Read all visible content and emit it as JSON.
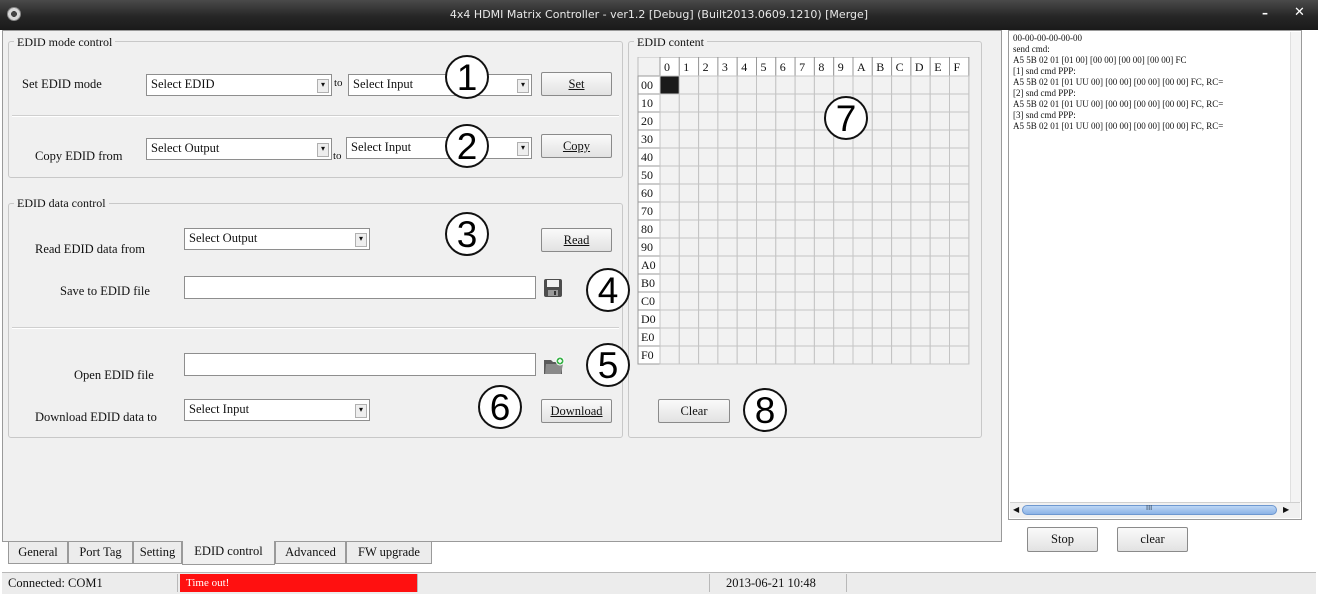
{
  "window": {
    "title": "4x4 HDMI Matrix Controller - ver1.2 [Debug]  (Built2013.0609.1210) [Merge]",
    "minimize_glyph": "–",
    "close_glyph": "✕"
  },
  "mode_control": {
    "group_title": "EDID mode control",
    "set_label": "Set EDID mode",
    "set_source": "Select EDID",
    "to_label": "to",
    "set_target": "Select Input",
    "set_button": "Set",
    "copy_label": "Copy EDID from",
    "copy_source": "Select Output",
    "copy_target": "Select Input",
    "copy_button": "Copy"
  },
  "data_control": {
    "group_title": "EDID data control",
    "read_label": "Read EDID data from",
    "read_source": "Select Output",
    "read_button": "Read",
    "save_label": "Save to EDID file",
    "save_value": "",
    "open_label": "Open EDID file",
    "open_value": "",
    "download_label": "Download EDID data to",
    "download_target": "Select Input",
    "download_button": "Download"
  },
  "edid_content": {
    "group_title": "EDID content",
    "columns": [
      "0",
      "1",
      "2",
      "3",
      "4",
      "5",
      "6",
      "7",
      "8",
      "9",
      "A",
      "B",
      "C",
      "D",
      "E",
      "F"
    ],
    "rows": [
      "00",
      "10",
      "20",
      "30",
      "40",
      "50",
      "60",
      "70",
      "80",
      "90",
      "A0",
      "B0",
      "C0",
      "D0",
      "E0",
      "F0"
    ],
    "selected_cell": {
      "row": "00",
      "col": "0"
    },
    "clear_button": "Clear"
  },
  "callouts": [
    "1",
    "2",
    "3",
    "4",
    "5",
    "6",
    "7",
    "8"
  ],
  "log": {
    "lines": [
      "00-00-00-00-00-00",
      "send cmd:",
      "A5 5B 02 01 [01 00] [00 00] [00 00] [00 00] FC",
      "[1] snd cmd PPP:",
      "A5 5B 02 01 [01 UU 00] [00 00] [00 00] [00 00] FC, RC=",
      "[2] snd cmd PPP:",
      "A5 5B 02 01 [01 UU 00] [00 00] [00 00] [00 00] FC, RC=",
      "[3] snd cmd PPP:",
      "A5 5B 02 01 [01 UU 00] [00 00] [00 00] [00 00] FC, RC="
    ],
    "scroll_mark": "III",
    "stop_button": "Stop",
    "clear_button": "clear"
  },
  "tabs": [
    {
      "label": "General"
    },
    {
      "label": "Port Tag"
    },
    {
      "label": "Setting"
    },
    {
      "label": "EDID control"
    },
    {
      "label": "Advanced"
    },
    {
      "label": "FW upgrade"
    }
  ],
  "status": {
    "connection": "Connected: COM1",
    "error": "Time out!",
    "error_color": "#ff1010",
    "datetime": "2013-06-21 10:48"
  },
  "icons": {
    "save": "floppy-disk-icon",
    "open": "folder-open-icon"
  }
}
